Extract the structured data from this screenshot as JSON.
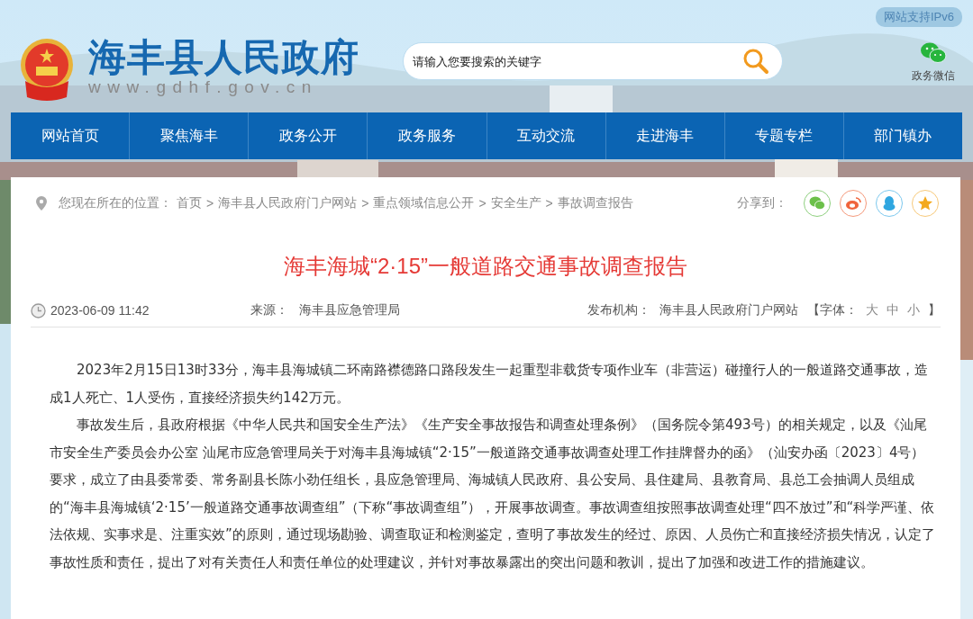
{
  "header": {
    "site_name": "海丰县人民政府",
    "site_url": "www.gdhf.gov.cn",
    "search": {
      "placeholder": "请输入您要搜索的关键字"
    },
    "ipv6_badge": "网站支持IPv6",
    "wechat_label": "政务微信"
  },
  "nav": [
    {
      "label": "网站首页"
    },
    {
      "label": "聚焦海丰"
    },
    {
      "label": "政务公开"
    },
    {
      "label": "政务服务"
    },
    {
      "label": "互动交流"
    },
    {
      "label": "走进海丰"
    },
    {
      "label": "专题专栏"
    },
    {
      "label": "部门镇办"
    }
  ],
  "breadcrumb": {
    "prefix": "您现在所在的位置：",
    "items": [
      "首页",
      ">",
      "海丰县人民政府门户网站",
      ">",
      "重点领域信息公开",
      ">",
      "安全生产",
      ">",
      "事故调查报告"
    ]
  },
  "share": {
    "label": "分享到："
  },
  "article": {
    "title": "海丰海城“2·15”一般道路交通事故调查报告",
    "date": "2023-06-09 11:42",
    "source_label": "来源：",
    "source": "海丰县应急管理局",
    "publisher_label": "发布机构：",
    "publisher": "海丰县人民政府门户网站",
    "font_size": {
      "open": "【字体：",
      "options": [
        "大",
        "中",
        "小"
      ],
      "close": "】"
    },
    "paragraphs": [
      "2023年2月15日13时33分，海丰县海城镇二环南路襟德路口路段发生一起重型非载货专项作业车（非营运）碰撞行人的一般道路交通事故，造成1人死亡、1人受伤，直接经济损失约142万元。",
      "事故发生后，县政府根据《中华人民共和国安全生产法》《生产安全事故报告和调查处理条例》（国务院令第493号）的相关规定，以及《汕尾市安全生产委员会办公室 汕尾市应急管理局关于对海丰县海城镇“2·15”一般道路交通事故调查处理工作挂牌督办的函》（汕安办函〔2023〕4号）要求，成立了由县委常委、常务副县长陈小劲任组长，县应急管理局、海城镇人民政府、县公安局、县住建局、县教育局、县总工会抽调人员组成的“海丰县海城镇‘2·15’一般道路交通事故调查组”（下称“事故调查组”），开展事故调查。事故调查组按照事故调查处理“四不放过”和“科学严谨、依法依规、实事求是、注重实效”的原则，通过现场勘验、调查取证和检测鉴定，查明了事故发生的经过、原因、人员伤亡和直接经济损失情况，认定了事故性质和责任，提出了对有关责任人和责任单位的处理建议，并针对事故暴露出的突出问题和教训，提出了加强和改进工作的措施建议。"
    ]
  }
}
